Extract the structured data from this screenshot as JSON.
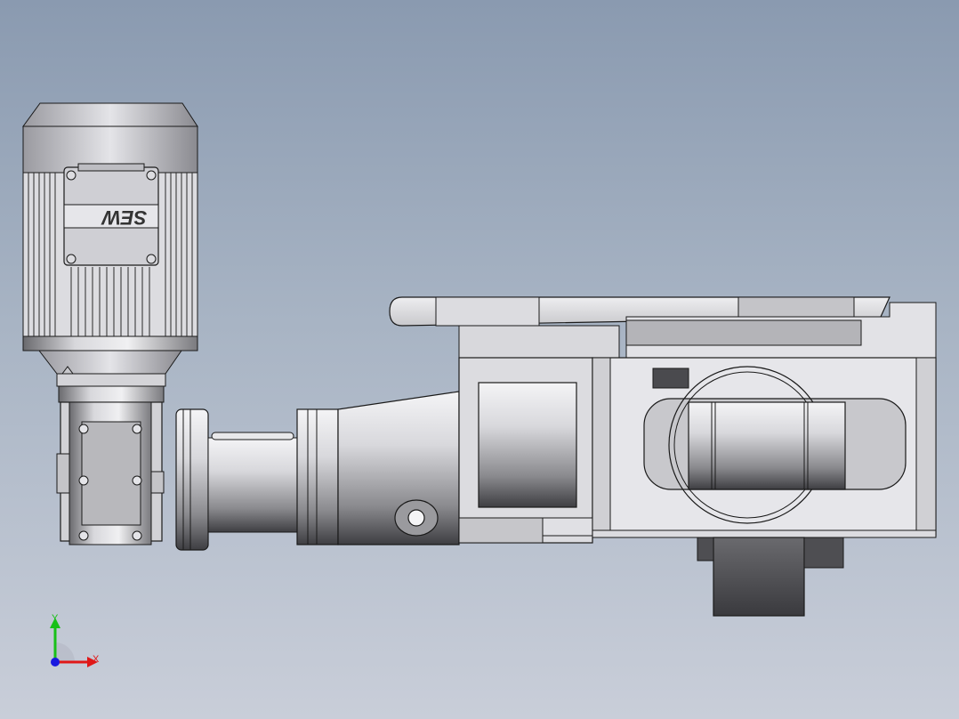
{
  "viewport": {
    "background_top": "#8a9ab0",
    "background_bottom": "#c9ced9"
  },
  "model": {
    "motor_brand": "SEW",
    "colors": {
      "metal_light": "#e8e8ea",
      "metal_mid": "#b8b8bc",
      "metal_dark": "#5a5a5e",
      "edge": "#1a1a1a"
    }
  },
  "triad": {
    "x_label": "X",
    "y_label": "Y",
    "x_color": "#e01818",
    "y_color": "#18c018",
    "z_color": "#1818e0"
  }
}
